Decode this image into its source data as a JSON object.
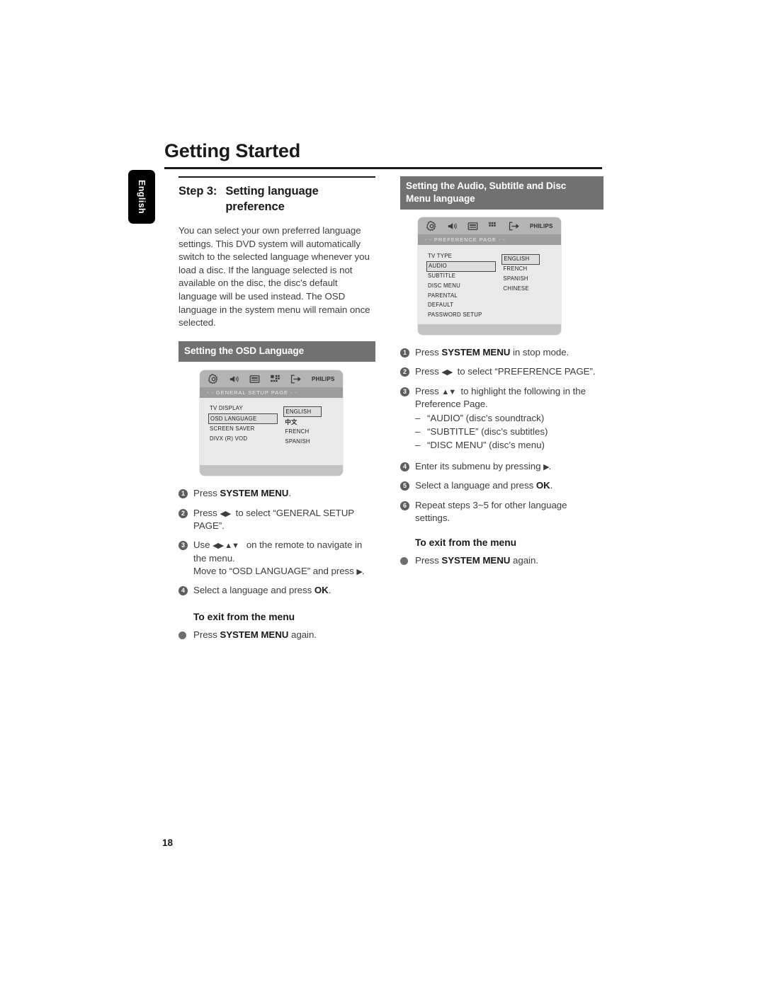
{
  "page": {
    "title": "Getting Started",
    "side_tab": "English",
    "page_number": "18"
  },
  "left_column": {
    "step_number": "Step 3:",
    "step_title_line1": "Setting language",
    "step_title_line2": "preference",
    "intro": "You can select your own preferred language settings. This DVD system will automatically switch to the selected language whenever you load a disc. If the language selected is not available on the disc, the disc's default language will be used instead. The OSD language in the system menu will remain once selected.",
    "section_bar": "Setting the OSD Language",
    "osd": {
      "brand": "PHILIPS",
      "page_title": "- -  GENERAL  SETUP  PAGE  - -",
      "menu_items": [
        {
          "label": "TV DISPLAY",
          "selected": false
        },
        {
          "label": "OSD LANGUAGE",
          "selected": true
        },
        {
          "label": "SCREEN SAVER",
          "selected": false
        },
        {
          "label": "DIVX (R) VOD",
          "selected": false
        }
      ],
      "options": [
        {
          "label": "ENGLISH",
          "selected": true,
          "cjk": false
        },
        {
          "label": "中文",
          "selected": false,
          "cjk": true
        },
        {
          "label": "FRENCH",
          "selected": false,
          "cjk": false
        },
        {
          "label": "SPANISH",
          "selected": false,
          "cjk": false
        }
      ]
    },
    "steps": [
      {
        "num": "1",
        "html": "Press <b>SYSTEM MENU</b>."
      },
      {
        "num": "2",
        "html": "Press <span class=\"arrows\">◀▶</span>&nbsp; to select “GENERAL SETUP PAGE”."
      },
      {
        "num": "3",
        "html": "Use <span class=\"arrows\">◀▶ ▲▼</span>&nbsp;&nbsp; on the remote to navigate in the menu.<br>Move to “OSD LANGUAGE” and press <span class=\"arrows\">▶</span>."
      },
      {
        "num": "4",
        "html": "Select a language and press <b>OK</b>."
      }
    ],
    "exit_heading": "To exit from the menu",
    "exit_text": "Press <b>SYSTEM MENU</b> again."
  },
  "right_column": {
    "section_bar_line1": "Setting the Audio, Subtitle and Disc",
    "section_bar_line2": "Menu language",
    "osd": {
      "brand": "PHILIPS",
      "page_title": "- -  PREFERENCE  PAGE  - -",
      "menu_items": [
        {
          "label": "TV TYPE",
          "selected": false
        },
        {
          "label": "AUDIO",
          "selected": true
        },
        {
          "label": "SUBTITLE",
          "selected": false
        },
        {
          "label": "DISC MENU",
          "selected": false
        },
        {
          "label": "PARENTAL",
          "selected": false
        },
        {
          "label": "DEFAULT",
          "selected": false
        },
        {
          "label": "PASSWORD SETUP",
          "selected": false
        }
      ],
      "options": [
        {
          "label": "ENGLISH",
          "selected": true
        },
        {
          "label": "FRENCH",
          "selected": false
        },
        {
          "label": "SPANISH",
          "selected": false
        },
        {
          "label": "CHINESE",
          "selected": false
        }
      ]
    },
    "steps": [
      {
        "num": "1",
        "html": "Press <b>SYSTEM MENU</b> in stop mode."
      },
      {
        "num": "2",
        "html": "Press <span class=\"arrows\">◀▶</span>&nbsp; to select “PREFERENCE PAGE”."
      },
      {
        "num": "3",
        "html": "Press <span class=\"arrows\">▲▼</span>&nbsp; to highlight the following in the Preference Page."
      }
    ],
    "sublist": [
      {
        "dash": "–",
        "text": "“AUDIO” (disc’s soundtrack)"
      },
      {
        "dash": "–",
        "text": "“SUBTITLE” (disc’s subtitles)"
      },
      {
        "dash": "–",
        "text": "“DISC MENU” (disc’s menu)"
      }
    ],
    "steps2": [
      {
        "num": "4",
        "html": "Enter its submenu by pressing <span class=\"arrows\">▶</span>."
      },
      {
        "num": "5",
        "html": "Select a language and press <b>OK</b>."
      },
      {
        "num": "6",
        "html": "Repeat steps 3~5 for other language settings."
      }
    ],
    "exit_heading": "To exit from the menu",
    "exit_text": "Press <b>SYSTEM MENU</b> again."
  },
  "icons": {
    "general_setup": "gear-icon",
    "audio_setup": "speaker-icon",
    "video_setup": "tv-screen-icon",
    "preference": "grid-squares-icon",
    "exit": "exit-arrow-icon"
  }
}
